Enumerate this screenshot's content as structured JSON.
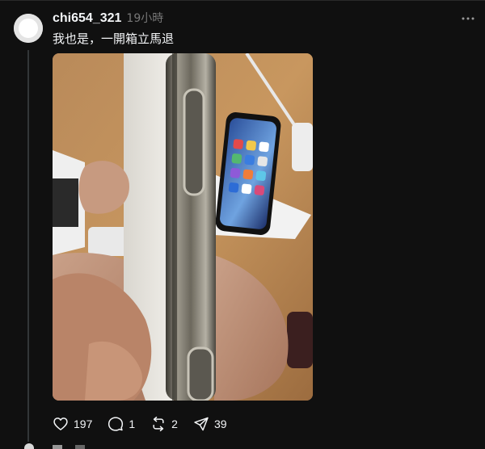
{
  "post": {
    "username": "chi654_321",
    "timestamp": "19小時",
    "text": "我也是，一開箱立馬退"
  },
  "actions": {
    "like_count": "197",
    "reply_count": "1",
    "repost_count": "2",
    "share_count": "39"
  },
  "icons": {
    "more": "more-horizontal-icon",
    "like": "heart-icon",
    "reply": "comment-bubble-icon",
    "repost": "repost-arrows-icon",
    "share": "send-paper-plane-icon"
  },
  "colors": {
    "background": "#101010",
    "text": "#f3f5f7",
    "muted": "#777777",
    "thread_line": "#333638"
  }
}
